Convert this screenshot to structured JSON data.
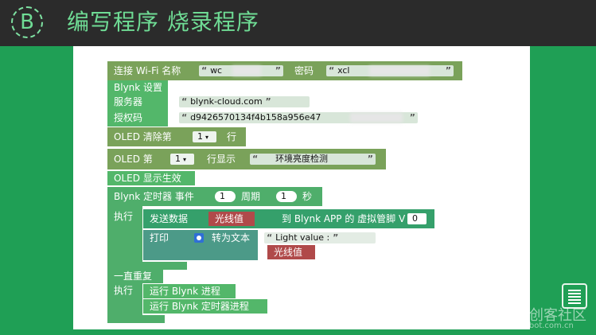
{
  "header": {
    "logo_letter": "B",
    "title": "编写程序 烧录程序"
  },
  "blocks": {
    "wifi": {
      "label": "连接 Wi-Fi 名称",
      "ssid": "wc",
      "pwd_label": "密码",
      "pwd": "xcl"
    },
    "blynk_setup": {
      "label": "Blynk 设置",
      "server_label": "服务器",
      "server": "blynk-cloud.com",
      "auth_label": "授权码",
      "auth": "d9426570134f4b158a956e47"
    },
    "oled_clear": {
      "label": "OLED 清除第",
      "num": "1",
      "suffix": "行"
    },
    "oled_line": {
      "label": "OLED 第",
      "num": "1",
      "mid": "行显示",
      "text": "环境亮度检测"
    },
    "oled_show": {
      "label": "OLED 显示生效"
    },
    "timer": {
      "label": "Blynk 定时器 事件",
      "num": "1",
      "period_label": "周期",
      "period": "1",
      "unit": "秒",
      "exec": "执行"
    },
    "send": {
      "label": "发送数据",
      "var": "光线值",
      "mid": "到 Blynk APP 的 虚拟管脚 V",
      "pin": "0"
    },
    "print": {
      "label": "打印",
      "convert": "转为文本",
      "text": "Light value :",
      "var": "光线值"
    },
    "loop": {
      "label": "一直重复",
      "exec": "执行",
      "run1": "运行 Blynk 进程",
      "run2": "运行 Blynk 定时器进程"
    }
  },
  "watermark": {
    "site_text": "创客社区",
    "url": "www.DFRobot.com.cn"
  }
}
